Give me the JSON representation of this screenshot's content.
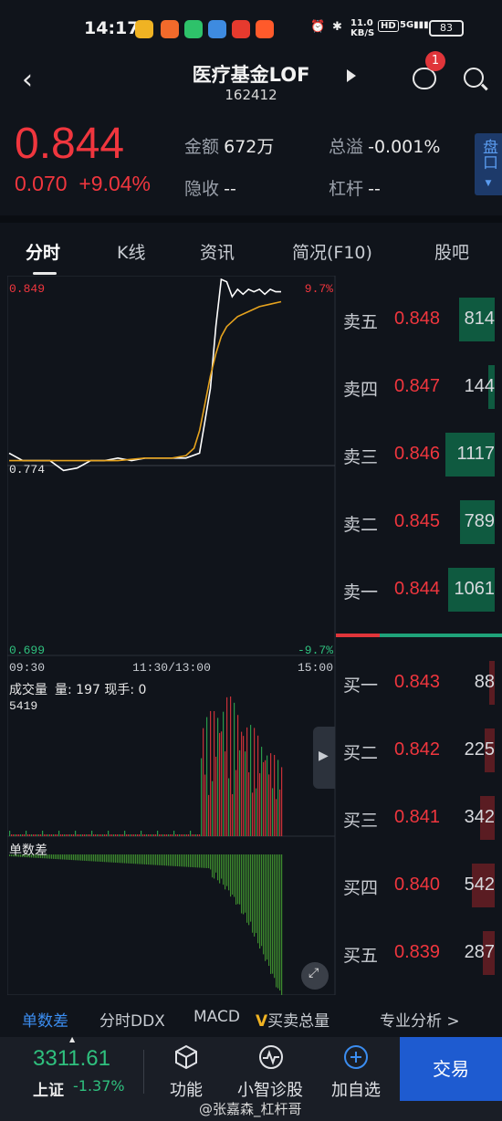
{
  "status_bar": {
    "time": "14:17",
    "net_speed": "11.0",
    "net_unit": "KB/S",
    "hd": "HD",
    "signal": "5G",
    "battery": "83"
  },
  "header": {
    "title": "医疗基金LOF",
    "code": "162412",
    "badge_count": "1"
  },
  "quote": {
    "price": "0.844",
    "change": "0.070",
    "change_pct": "+9.04%",
    "amount_label": "金额",
    "amount_value": "672万",
    "premium_label": "总溢",
    "premium_value": "-0.001%",
    "implied_label": "隐收",
    "implied_value": "--",
    "leverage_label": "杠杆",
    "leverage_value": "--",
    "pankou_label": "盘口"
  },
  "tabs": [
    "分时",
    "K线",
    "资讯",
    "简况(F10)",
    "股吧"
  ],
  "chart": {
    "y_high": "0.849",
    "y_high_pct": "9.7%",
    "y_mid": "0.774",
    "y_low": "0.699",
    "y_low_pct": "-9.7%",
    "time_start": "09:30",
    "time_mid": "11:30/13:00",
    "time_end": "15:00",
    "volume_title": "成交量",
    "volume_info": "量: 197  现手: 0",
    "volume_max": "5419",
    "indicator_title": "单数差"
  },
  "chart_data": {
    "type": "line",
    "series": [
      {
        "color": "#ffffff",
        "x": [
          0,
          5,
          10,
          15,
          20,
          25,
          30,
          35,
          40,
          45,
          50,
          55,
          60,
          65,
          70,
          72,
          74,
          76,
          78,
          80,
          82,
          84,
          86,
          88,
          90,
          92,
          94,
          96,
          98,
          100
        ],
        "values": [
          0.779,
          0.776,
          0.776,
          0.776,
          0.772,
          0.773,
          0.776,
          0.776,
          0.777,
          0.776,
          0.777,
          0.777,
          0.777,
          0.777,
          0.779,
          0.792,
          0.805,
          0.83,
          0.849,
          0.848,
          0.842,
          0.845,
          0.843,
          0.845,
          0.844,
          0.845,
          0.843,
          0.845,
          0.844,
          0.844
        ]
      },
      {
        "color": "#e6a31e",
        "x": [
          0,
          10,
          20,
          30,
          40,
          50,
          60,
          65,
          68,
          70,
          72,
          74,
          76,
          78,
          80,
          84,
          88,
          92,
          96,
          100
        ],
        "values": [
          0.776,
          0.776,
          0.776,
          0.776,
          0.776,
          0.777,
          0.777,
          0.778,
          0.781,
          0.788,
          0.799,
          0.81,
          0.819,
          0.826,
          0.83,
          0.834,
          0.836,
          0.838,
          0.839,
          0.84
        ]
      }
    ],
    "ylim": [
      0.699,
      0.849
    ]
  },
  "orderbook": {
    "sell": [
      {
        "label": "卖五",
        "price": "0.848",
        "vol": "814",
        "fill": 0.29
      },
      {
        "label": "卖四",
        "price": "0.847",
        "vol": "144",
        "fill": 0.05
      },
      {
        "label": "卖三",
        "price": "0.846",
        "vol": "1117",
        "fill": 0.4
      },
      {
        "label": "卖二",
        "price": "0.845",
        "vol": "789",
        "fill": 0.28
      },
      {
        "label": "卖一",
        "price": "0.844",
        "vol": "1061",
        "fill": 0.38
      }
    ],
    "buy": [
      {
        "label": "买一",
        "price": "0.843",
        "vol": "88",
        "fill": 0.03
      },
      {
        "label": "买二",
        "price": "0.842",
        "vol": "225",
        "fill": 0.08
      },
      {
        "label": "买三",
        "price": "0.841",
        "vol": "342",
        "fill": 0.12
      },
      {
        "label": "买四",
        "price": "0.840",
        "vol": "542",
        "fill": 0.19
      },
      {
        "label": "买五",
        "price": "0.839",
        "vol": "287",
        "fill": 0.1
      }
    ]
  },
  "indicator_tabs": {
    "t1": "单数差",
    "t2": "分时DDX",
    "t3": "MACD",
    "t4_prefix": "V",
    "t4": "买卖总量",
    "t5": "专业分析 >"
  },
  "bottom": {
    "index_value": "3311.61",
    "index_name": "上证",
    "index_change": "-1.37%",
    "func_label": "功能",
    "diag_label": "小智诊股",
    "add_label": "加自选",
    "trade_label": "交易",
    "watermark": "@张嘉森_杠杆哥"
  }
}
